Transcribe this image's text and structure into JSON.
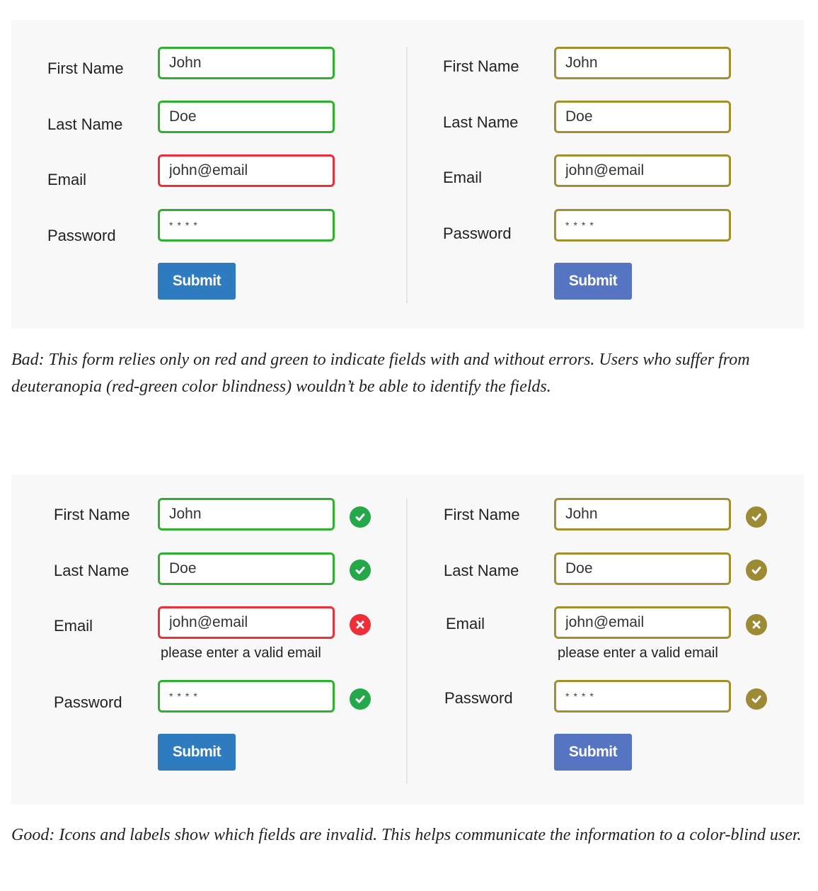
{
  "bad_example": {
    "left_form": {
      "first_name_label": "First Name",
      "first_name_value": "John",
      "last_name_label": "Last Name",
      "last_name_value": "Doe",
      "email_label": "Email",
      "email_value": "john@email",
      "password_label": "Password",
      "password_value": "****",
      "submit_label": "Submit"
    },
    "right_form": {
      "first_name_label": "First Name",
      "first_name_value": "John",
      "last_name_label": "Last Name",
      "last_name_value": "Doe",
      "email_label": "Email",
      "email_value": "john@email",
      "password_label": "Password",
      "password_value": "****",
      "submit_label": "Submit"
    },
    "caption": "Bad: This form relies only on red and green to indicate fields with and without errors. Users who suffer from deuteranopia (red-green color blindness) wouldn’t be able to identify the fields."
  },
  "good_example": {
    "left_form": {
      "first_name_label": "First Name",
      "first_name_value": "John",
      "last_name_label": "Last Name",
      "last_name_value": "Doe",
      "email_label": "Email",
      "email_value": "john@email",
      "email_error": "please enter a valid email",
      "password_label": "Password",
      "password_value": "****",
      "submit_label": "Submit"
    },
    "right_form": {
      "first_name_label": "First Name",
      "first_name_value": "John",
      "last_name_label": "Last Name",
      "last_name_value": "Doe",
      "email_label": "Email",
      "email_value": "john@email",
      "email_error": "please enter a valid email",
      "password_label": "Password",
      "password_value": "****",
      "submit_label": "Submit"
    },
    "icons": {
      "valid": "check-circle-icon",
      "invalid": "x-circle-icon"
    },
    "caption": "Good: Icons and labels show which fields are invalid. This helps communicate the information to a color-blind user."
  },
  "colors": {
    "valid_green": "#2fb12f",
    "error_red": "#ee2f3a",
    "colorblind_olive": "#a48f2e",
    "submit_blue": "#2e7cbf",
    "submit_colorblind": "#5574c2",
    "panel_background": "#f7f8f7"
  }
}
